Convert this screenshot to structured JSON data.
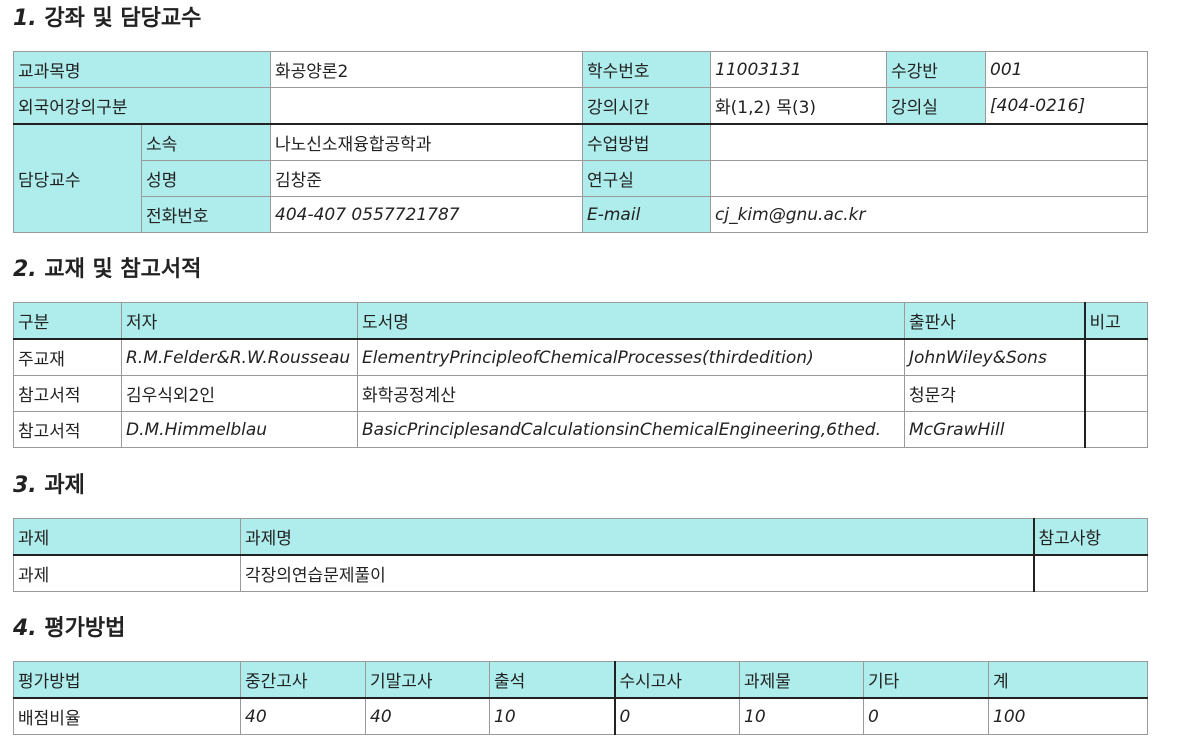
{
  "sections": {
    "s1": {
      "num": "1.",
      "title": "강좌 및 담당교수"
    },
    "s2": {
      "num": "2.",
      "title": "교재 및 참고서적"
    },
    "s3": {
      "num": "3.",
      "title": "과제"
    },
    "s4": {
      "num": "4.",
      "title": "평가방법"
    }
  },
  "course": {
    "name_label": "교과목명",
    "name_value": "화공양론2",
    "code_label": "학수번호",
    "code_value": "11003131",
    "class_label": "수강반",
    "class_value": "001",
    "foreign_label": "외국어강의구분",
    "foreign_value": "",
    "time_label": "강의시간",
    "time_value": "화(1,2) 목(3)",
    "room_label": "강의실",
    "room_value": "[404-0216]",
    "professor_label": "담당교수",
    "dept_label": "소속",
    "dept_value": "나노신소재융합공학과",
    "method_label": "수업방법",
    "method_value": "",
    "pname_label": "성명",
    "pname_value": "김창준",
    "office_label": "연구실",
    "office_value": "",
    "phone_label": "전화번호",
    "phone_value": "404-407 0557721787",
    "email_label": "E-mail",
    "email_value": "cj_kim@gnu.ac.kr"
  },
  "books": {
    "headers": [
      "구분",
      "저자",
      "도서명",
      "출판사",
      "비고"
    ],
    "rows": [
      [
        "주교재",
        "R.M.Felder&R.W.Rousseau",
        "ElementryPrincipleofChemicalProcesses(thirdedition)",
        "JohnWiley&Sons",
        ""
      ],
      [
        "참고서적",
        "김우식외2인",
        "화학공정계산",
        "청문각",
        ""
      ],
      [
        "참고서적",
        "D.M.Himmelblau",
        "BasicPrinciplesandCalculationsinChemicalEngineering,6thed.",
        "McGrawHill",
        ""
      ]
    ]
  },
  "assignments": {
    "headers": [
      "과제",
      "과제명",
      "참고사항"
    ],
    "rows": [
      [
        "과제",
        "각장의연습문제풀이",
        ""
      ]
    ]
  },
  "grading": {
    "headers": [
      "평가방법",
      "중간고사",
      "기말고사",
      "출석",
      "수시고사",
      "과제물",
      "기타",
      "계"
    ],
    "label": "배점비율",
    "values": [
      "40",
      "40",
      "10",
      "0",
      "10",
      "0",
      "100"
    ]
  }
}
